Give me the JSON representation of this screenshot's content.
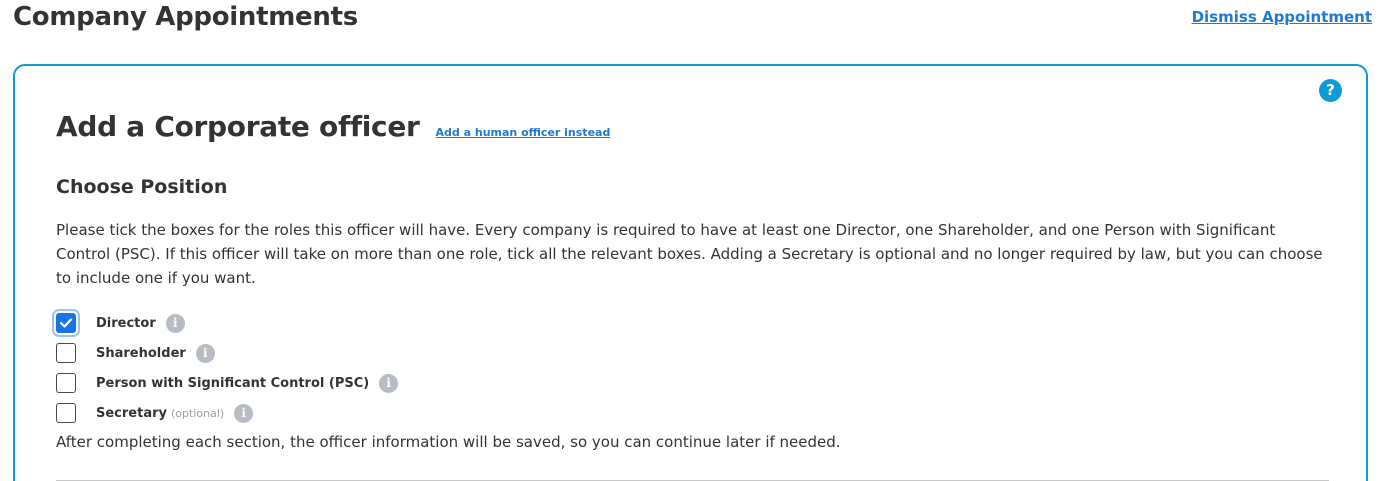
{
  "header": {
    "title": "Company Appointments",
    "dismiss_link": "Dismiss Appointment"
  },
  "card": {
    "help_icon": "?",
    "title": "Add a Corporate officer",
    "human_officer_link": "Add a human officer instead",
    "section_title": "Choose Position",
    "description": "Please tick the boxes for the roles this officer will have. Every company is required to have at least one Director, one Shareholder, and one Person with Significant Control (PSC). If this officer will take on more than one role, tick all the relevant boxes. Adding a Secretary is optional and no longer required by law, but you can choose to include one if you want.",
    "positions": [
      {
        "label": "Director",
        "checked": true,
        "optional_note": ""
      },
      {
        "label": "Shareholder",
        "checked": false,
        "optional_note": ""
      },
      {
        "label": "Person with Significant Control (PSC)",
        "checked": false,
        "optional_note": ""
      },
      {
        "label": "Secretary",
        "checked": false,
        "optional_note": "(optional)"
      }
    ],
    "info_icon": "i",
    "save_note": "After completing each section, the officer information will be saved, so you can continue later if needed."
  },
  "colors": {
    "accent": "#0d9bd8",
    "link": "#1f7ad1",
    "checkbox_checked": "#1a73e8",
    "info_icon": "#b7bcc2"
  }
}
